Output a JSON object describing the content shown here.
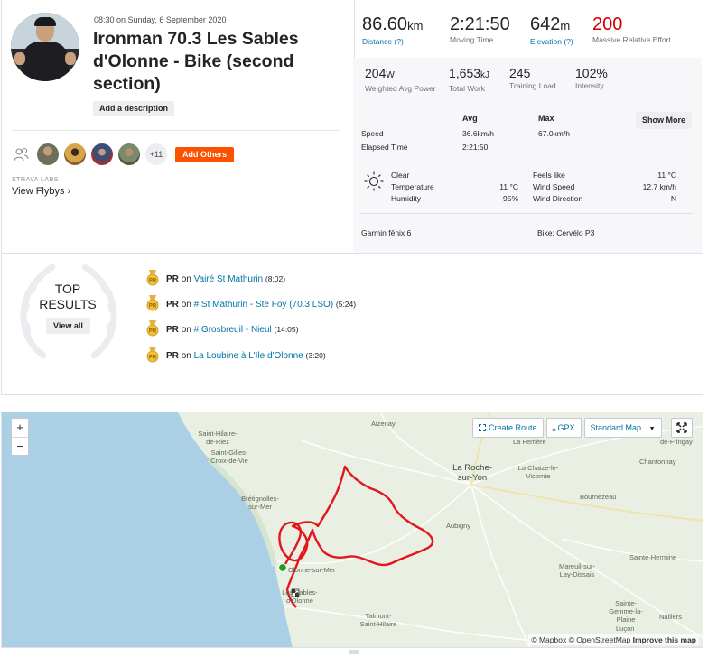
{
  "activity": {
    "datetime": "08:30 on Sunday, 6 September 2020",
    "title": "Ironman 70.3 Les Sables d'Olonne - Bike (second section)",
    "add_description_label": "Add a description"
  },
  "group": {
    "more_count": "+11",
    "add_others_label": "Add Others"
  },
  "flybys": {
    "labs_label": "STRAVA LABS",
    "link_label": "View Flybys"
  },
  "primary_stats": [
    {
      "value": "86.60",
      "unit": "km",
      "label": "Distance (?)"
    },
    {
      "value": "2:21:50",
      "unit": "",
      "label": "Moving Time"
    },
    {
      "value": "642",
      "unit": "m",
      "label": "Elevation (?)"
    },
    {
      "value": "200",
      "unit": "",
      "label": "Massive Relative Effort"
    }
  ],
  "secondary_stats": [
    {
      "value": "204",
      "unit": "W",
      "label": "Weighted Avg Power"
    },
    {
      "value": "1,653",
      "unit": "kJ",
      "label": "Total Work"
    },
    {
      "value": "245",
      "unit": "",
      "label": "Training Load"
    },
    {
      "value": "102%",
      "unit": "",
      "label": "Intensity"
    }
  ],
  "detail_table": {
    "headers": {
      "avg": "Avg",
      "max": "Max"
    },
    "show_more_label": "Show More",
    "rows": [
      {
        "label": "Speed",
        "avg": "36.6km/h",
        "max": "67.0km/h"
      },
      {
        "label": "Elapsed Time",
        "avg": "2:21:50",
        "max": ""
      }
    ]
  },
  "weather": {
    "condition": "Clear",
    "temperature_label": "Temperature",
    "temperature": "11 °C",
    "humidity_label": "Humidity",
    "humidity": "95%",
    "feels_like_label": "Feels like",
    "feels_like": "11 °C",
    "wind_speed_label": "Wind Speed",
    "wind_speed": "12.7 km/h",
    "wind_direction_label": "Wind Direction",
    "wind_direction": "N"
  },
  "gear": {
    "device": "Garmin fēnix 6",
    "bike": "Bike: Cervélo P3"
  },
  "top_results": {
    "heading_line1": "TOP",
    "heading_line2": "RESULTS",
    "view_all_label": "View all",
    "items": [
      {
        "badge": "PR",
        "on": "on",
        "segment": "Vairé St Mathurin",
        "time": "(8:02)"
      },
      {
        "badge": "PR",
        "on": "on",
        "segment": "# St Mathurin - Ste Foy (70.3 LSO)",
        "time": "(5:24)"
      },
      {
        "badge": "PR",
        "on": "on",
        "segment": "# Grosbreuil - Nieul",
        "time": "(14:05)"
      },
      {
        "badge": "PR",
        "on": "on",
        "segment": "La Loubine à L'Ile d'Olonne",
        "time": "(3:20)"
      }
    ]
  },
  "map": {
    "zoom_in": "+",
    "zoom_out": "−",
    "create_route_label": "Create Route",
    "gpx_label": "GPX",
    "map_type_label": "Standard Map",
    "attribution_mapbox": "© Mapbox",
    "attribution_osm": "© OpenStreetMap",
    "attribution_improve": "Improve this map",
    "places": [
      "Aizenay",
      "Saint-Hilaire-de-Riez",
      "Saint-Gilles-Croix-de-Vie",
      "La Ferrière",
      "Chantonnay",
      "de-Fringay",
      "La Roche-sur-Yon",
      "La Chaize-le-Vicomte",
      "Brétignolles-sur-Mer",
      "Bournezeau",
      "Aubigny",
      "Sainte-Hermine",
      "Olonne-sur-Mer",
      "Mareuil-sur-Lay-Dissais",
      "Les Sables-d'Olonne",
      "Sainte-Gemme-la-Plaine",
      "Talmont-Saint-Hilaire",
      "Nalliers",
      "Luçon"
    ]
  },
  "colors": {
    "brand": "#fc5200",
    "link": "#0073a6",
    "effort_red": "#cc0000",
    "route": "#e3161c"
  }
}
